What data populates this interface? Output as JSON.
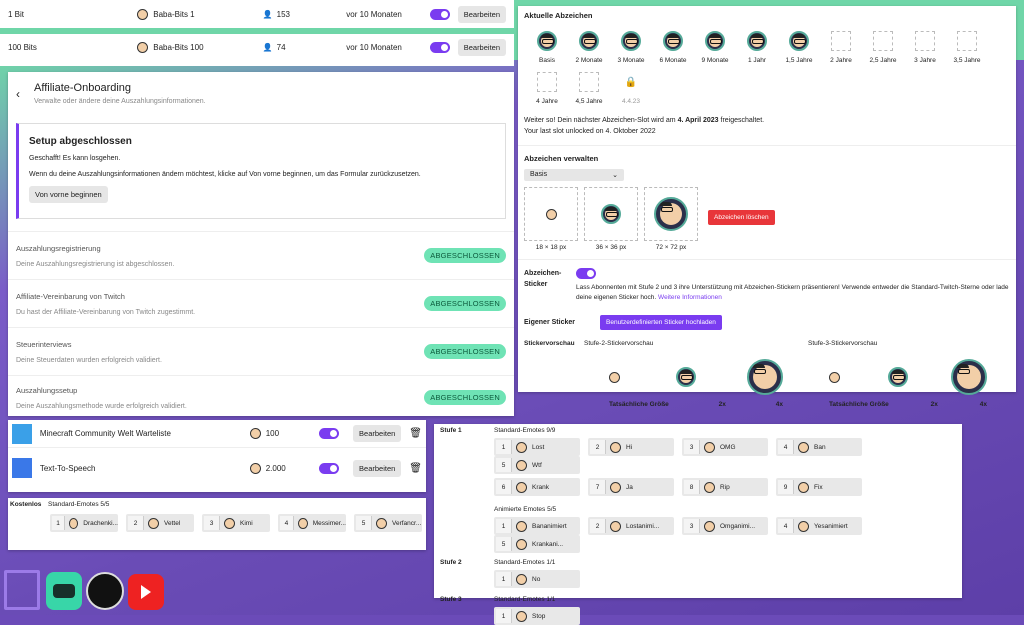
{
  "rewards_top": [
    {
      "name": "1 Bit",
      "badge": "Baba-Bits 1",
      "count": "153",
      "time": "vor 10 Monaten",
      "action": "Bearbeiten"
    },
    {
      "name": "100 Bits",
      "badge": "Baba-Bits 100",
      "count": "74",
      "time": "vor 10 Monaten",
      "action": "Bearbeiten"
    }
  ],
  "affiliate": {
    "title": "Affiliate-Onboarding",
    "subtitle": "Verwalte oder ändere deine Auszahlungsinformationen.",
    "setup_title": "Setup abgeschlossen",
    "setup_line1": "Geschafft! Es kann losgehen.",
    "setup_line2": "Wenn du deine Auszahlungsinformationen ändern möchtest, klicke auf Von vorne beginnen, um das Formular zurückzusetzen.",
    "restart": "Von vorne beginnen",
    "steps": [
      {
        "title": "Auszahlungsregistrierung",
        "desc": "Deine Auszahlungsregistrierung ist abgeschlossen.",
        "status": "ABGESCHLOSSEN"
      },
      {
        "title": "Affiliate-Vereinbarung von Twitch",
        "desc": "Du hast der Affiliate-Vereinbarung von Twitch zugestimmt.",
        "status": "ABGESCHLOSSEN"
      },
      {
        "title": "Steuerinterviews",
        "desc": "Deine Steuerdaten wurden erfolgreich validiert.",
        "status": "ABGESCHLOSSEN"
      },
      {
        "title": "Auszahlungssetup",
        "desc": "Deine Auszahlungsmethode wurde erfolgreich validiert.",
        "status": "ABGESCHLOSSEN"
      }
    ]
  },
  "rewards_bottom": [
    {
      "name": "Minecraft Community Welt Warteliste",
      "cost": "100",
      "action": "Bearbeiten"
    },
    {
      "name": "Text-To-Speech",
      "cost": "2.000",
      "action": "Bearbeiten"
    }
  ],
  "kostenlos": {
    "label": "Kostenlos",
    "header": "Standard-Emotes 5/5",
    "emotes": [
      {
        "n": "1",
        "name": "Drachenki..."
      },
      {
        "n": "2",
        "name": "Vettel"
      },
      {
        "n": "3",
        "name": "Kimi"
      },
      {
        "n": "4",
        "name": "Messimer..."
      },
      {
        "n": "5",
        "name": "Verfancr..."
      }
    ]
  },
  "badges": {
    "title": "Aktuelle Abzeichen",
    "row1": [
      "Basis",
      "2 Monate",
      "3 Monate",
      "6 Monate",
      "9 Monate",
      "1 Jahr",
      "1,5 Jahre",
      "2 Jahre",
      "2,5 Jahre",
      "3 Jahre",
      "3,5 Jahre"
    ],
    "row2": [
      "4 Jahre",
      "4,5 Jahre",
      "4.4.23"
    ],
    "info_pre": "Weiter so! Dein nächster Abzeichen-Slot wird am ",
    "info_date": "4. April 2023",
    "info_post": " freigeschaltet.",
    "info2": "Your last slot unlocked on 4. Oktober 2022",
    "manage_title": "Abzeichen verwalten",
    "select": "Basis",
    "sizes": [
      "18 × 18 px",
      "36 × 36 px",
      "72 × 72 px"
    ],
    "delete": "Abzeichen löschen",
    "sticker_label": "Abzeichen-Sticker",
    "sticker_text": "Lass Abonnenten mit Stufe 2 und 3 ihre Unterstützung mit Abzeichen-Stickern präsentieren! Verwende entweder die Standard-Twitch-Sterne oder lade deine eigenen Sticker hoch.",
    "sticker_link": "Weitere Informationen",
    "own_label": "Eigener Sticker",
    "upload": "Benutzerdefinierten Sticker hochladen",
    "preview_label": "Stickervorschau",
    "tier2": "Stufe-2-Stickervorschau",
    "tier3": "Stufe-3-Stickervorschau",
    "actual": "Tatsächliche Größe",
    "x2": "2x",
    "x4": "4x"
  },
  "emotes": {
    "tier1": "Stufe 1",
    "tier1_std": "Standard-Emotes 9/9",
    "tier1_list": [
      {
        "n": "1",
        "name": "Lost"
      },
      {
        "n": "2",
        "name": "Hi"
      },
      {
        "n": "3",
        "name": "OMG"
      },
      {
        "n": "4",
        "name": "Ban"
      },
      {
        "n": "5",
        "name": "Wtf"
      },
      {
        "n": "6",
        "name": "Krank"
      },
      {
        "n": "7",
        "name": "Ja"
      },
      {
        "n": "8",
        "name": "Rip"
      },
      {
        "n": "9",
        "name": "Fix"
      }
    ],
    "animated": "Animierte Emotes 5/5",
    "animated_list": [
      {
        "n": "1",
        "name": "Bananimiert"
      },
      {
        "n": "2",
        "name": "Lostanimi..."
      },
      {
        "n": "3",
        "name": "Omganimi..."
      },
      {
        "n": "4",
        "name": "Yesanimiert"
      },
      {
        "n": "5",
        "name": "Krankani..."
      }
    ],
    "tier2": "Stufe 2",
    "tier2_std": "Standard-Emotes 1/1",
    "tier2_list": [
      {
        "n": "1",
        "name": "No"
      }
    ],
    "tier3": "Stufe 3",
    "tier3_std": "Standard-Emotes 1/1",
    "tier3_list": [
      {
        "n": "1",
        "name": "Stop"
      }
    ]
  },
  "colors": {
    "accent": "#7a3cf0",
    "green": "#6fe3b5",
    "danger": "#e8363a"
  },
  "logos": [
    "twitch-logo",
    "streamlabs-logo",
    "obs-logo",
    "youtube-logo"
  ]
}
